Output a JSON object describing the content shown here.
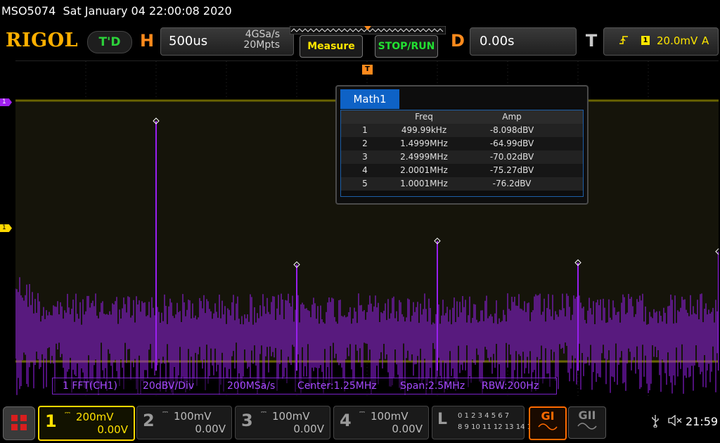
{
  "status": {
    "model": "MSO5074",
    "datetime": "Sat January 04 22:00:08 2020"
  },
  "brand": {
    "logo": "RIGOL",
    "mode_badge": "T'D"
  },
  "horizontal": {
    "letter": "H",
    "timebase": "500us",
    "sample_rate": "4GSa/s",
    "memory_depth": "20Mpts"
  },
  "buttons": {
    "measure": "Measure",
    "stop_run": "STOP/RUN"
  },
  "delay": {
    "letter": "D",
    "value": "0.00s"
  },
  "trigger": {
    "letter": "T",
    "edge_icon": "rising-edge-icon",
    "source": "1",
    "level": "20.0mV",
    "coupling": "A"
  },
  "markers": {
    "math": "1",
    "ch1": "1",
    "trigger": "T"
  },
  "math_panel": {
    "tab": "Math1",
    "headers": {
      "freq": "Freq",
      "amp": "Amp"
    },
    "rows": [
      {
        "idx": "1",
        "freq": "499.99kHz",
        "amp": "-8.098dBV"
      },
      {
        "idx": "2",
        "freq": "1.4999MHz",
        "amp": "-64.99dBV"
      },
      {
        "idx": "3",
        "freq": "2.4999MHz",
        "amp": "-70.02dBV"
      },
      {
        "idx": "4",
        "freq": "2.0001MHz",
        "amp": "-75.27dBV"
      },
      {
        "idx": "5",
        "freq": "1.0001MHz",
        "amp": "-76.2dBV"
      }
    ]
  },
  "fft_info": {
    "source": "1 FFT(CH1)",
    "scale": "20dBV/Div",
    "rate": "200MSa/s",
    "center": "Center:1.25MHz",
    "span": "Span:2.5MHz",
    "rbw": "RBW:200Hz"
  },
  "channels": [
    {
      "num": "1",
      "coupling": "⎓",
      "scale": "200mV",
      "offset": "0.00V"
    },
    {
      "num": "2",
      "coupling": "⎓",
      "scale": "100mV",
      "offset": "0.00V"
    },
    {
      "num": "3",
      "coupling": "⎓",
      "scale": "100mV",
      "offset": "0.00V"
    },
    {
      "num": "4",
      "coupling": "⎓",
      "scale": "100mV",
      "offset": "0.00V"
    }
  ],
  "logic": {
    "letter": "L",
    "row1": "0 1 2 3  4 5 6 7",
    "row2": "8 9 10 11 12 13 14 15"
  },
  "generators": {
    "g1": "GI",
    "g2": "GII"
  },
  "system": {
    "clock": "21:59"
  },
  "colors": {
    "math_trace": "#9b1ff2",
    "ch1": "#ffd800",
    "accent": "#ff8a1c",
    "table_tab": "#0e62c6"
  },
  "chart_data": {
    "type": "line",
    "title": "",
    "x_range_MHz": [
      0,
      2.5
    ],
    "y_unit": "dBV",
    "peaks": [
      {
        "x": 0.49999,
        "y": -8.098
      },
      {
        "x": 1.0001,
        "y": -76.2
      },
      {
        "x": 1.4999,
        "y": -64.99
      },
      {
        "x": 2.0001,
        "y": -75.27
      },
      {
        "x": 2.4999,
        "y": -70.02
      }
    ]
  }
}
